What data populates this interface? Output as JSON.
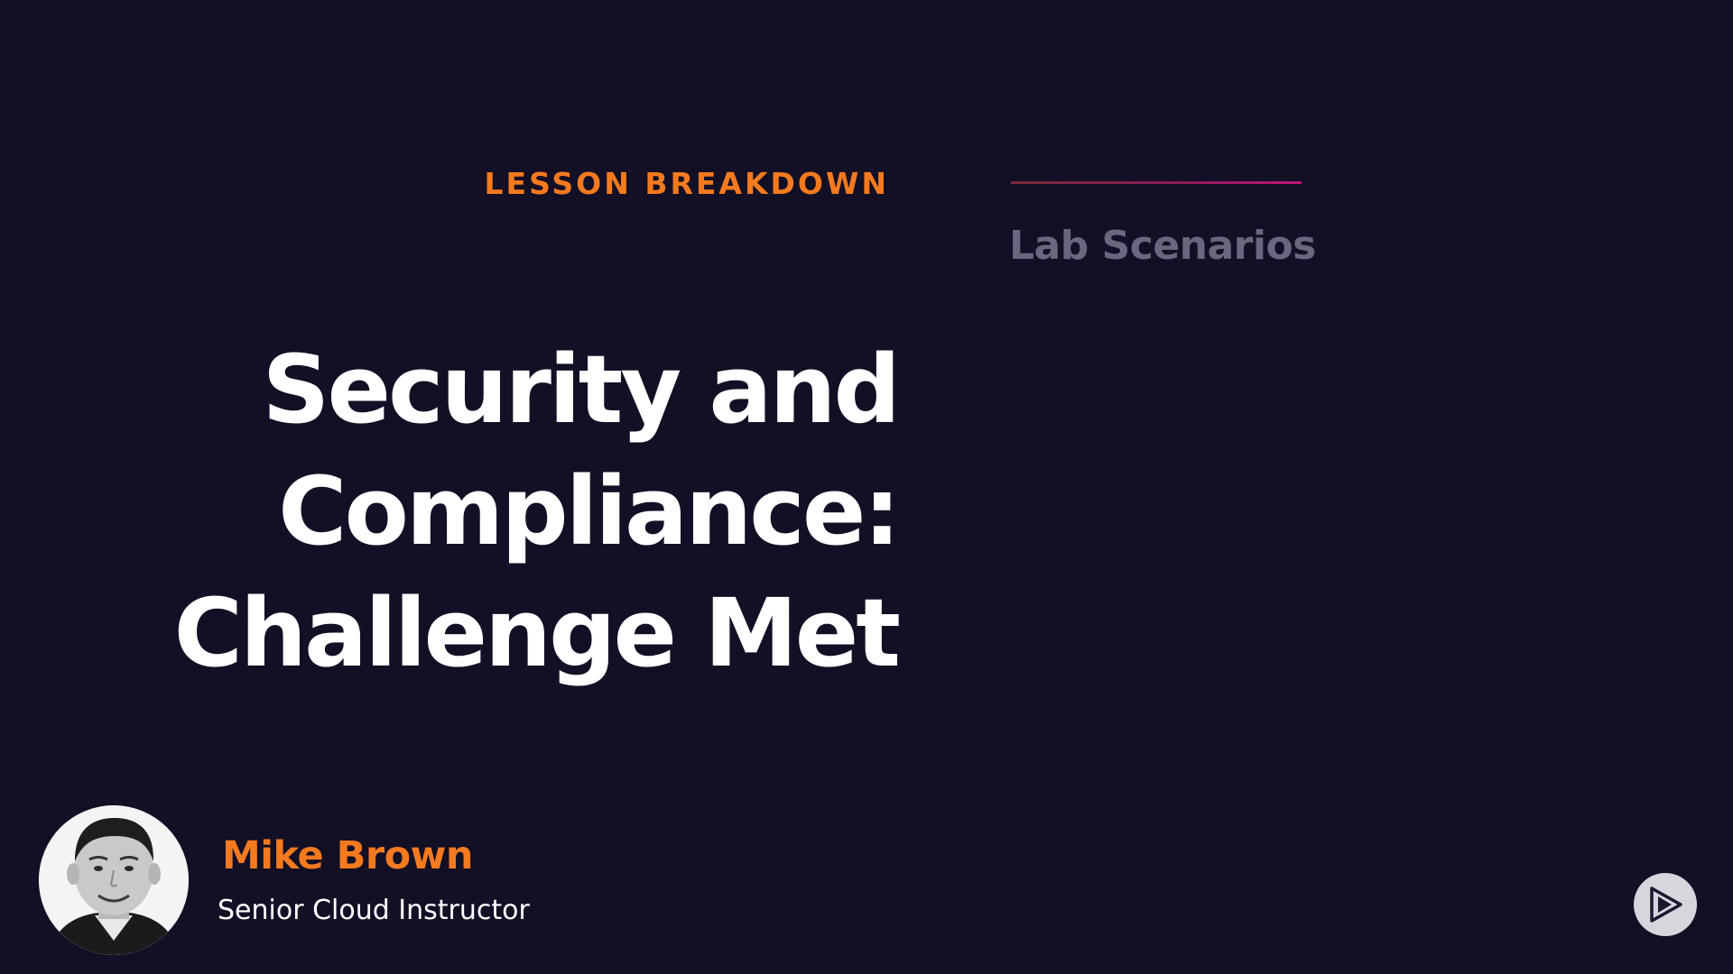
{
  "slide": {
    "eyebrow": "LESSON BREAKDOWN",
    "title_lines": [
      "Security and",
      "Compliance:",
      "Challenge Met"
    ],
    "section_label": "Lab Scenarios"
  },
  "presenter": {
    "name": "Mike Brown",
    "role": "Senior Cloud Instructor",
    "photo_icon": "avatar-photo"
  },
  "controls": {
    "play_icon": "play-logo-icon"
  },
  "colors": {
    "background": "#130f25",
    "accent_orange": "#f47a1f",
    "title_white": "#ffffff",
    "muted_label": "#6b6680",
    "rule_gradient_start": "#7a2a3a",
    "rule_gradient_end": "#c0157a",
    "button_bg": "#d7d6dc"
  }
}
